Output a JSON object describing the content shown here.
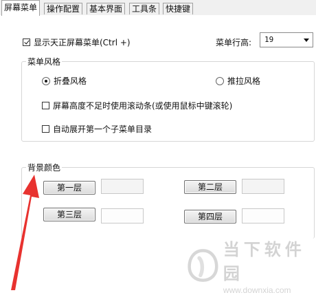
{
  "tabs": [
    {
      "label": "屏幕菜单",
      "active": true
    },
    {
      "label": "操作配置",
      "active": false
    },
    {
      "label": "基本界面",
      "active": false
    },
    {
      "label": "工具条",
      "active": false
    },
    {
      "label": "快捷键",
      "active": false
    }
  ],
  "show_menu": {
    "label": "显示天正屏幕菜单(Ctrl +)",
    "checked": true
  },
  "menu_rows": {
    "label": "菜单行高:",
    "value": "19"
  },
  "menu_style": {
    "title": "菜单风格",
    "fold_label": "折叠风格",
    "push_label": "推拉风格",
    "selected": "fold",
    "scrollbar_label": "屏幕高度不足时使用滚动条(或使用鼠标中键滚轮)",
    "auto_expand_label": "自动展开第一个子菜单目录"
  },
  "bg_color": {
    "title": "背景颜色",
    "layer1": "第一层",
    "layer2": "第二层",
    "layer3": "第三层",
    "layer4": "第四层"
  },
  "watermark": {
    "name": "当下软件园",
    "url": "www.downxia.com"
  },
  "colors": {
    "annotation_arrow": "#e8322f"
  }
}
